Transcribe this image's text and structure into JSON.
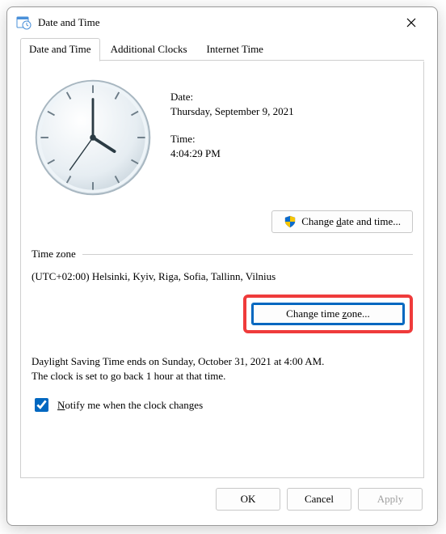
{
  "window": {
    "title": "Date and Time"
  },
  "tabs": {
    "t0": "Date and Time",
    "t1": "Additional Clocks",
    "t2": "Internet Time"
  },
  "datetime": {
    "date_label": "Date:",
    "date_value": "Thursday, September 9, 2021",
    "time_label": "Time:",
    "time_value": "4:04:29 PM",
    "change_button": "Change date and time..."
  },
  "timezone": {
    "legend": "Time zone",
    "value": "(UTC+02:00) Helsinki, Kyiv, Riga, Sofia, Tallinn, Vilnius",
    "change_button": "Change time zone..."
  },
  "dst": {
    "line1": "Daylight Saving Time ends on Sunday, October 31, 2021 at 4:00 AM.",
    "line2": "The clock is set to go back 1 hour at that time."
  },
  "notify": {
    "checked": true,
    "label_prefix": "N",
    "label_rest": "otify me when the clock changes"
  },
  "footer": {
    "ok": "OK",
    "cancel": "Cancel",
    "apply": "Apply"
  }
}
